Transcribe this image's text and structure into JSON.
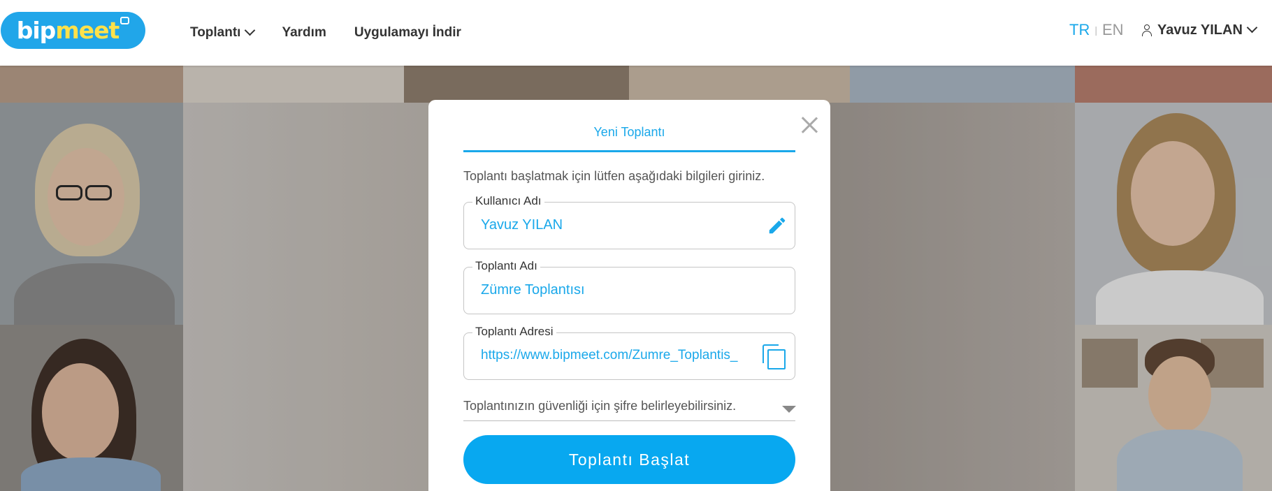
{
  "logo": {
    "part1": "bip",
    "part2": "meet"
  },
  "nav": {
    "meeting": "Toplantı",
    "help": "Yardım",
    "download": "Uygulamayı İndir"
  },
  "lang": {
    "tr": "TR",
    "separator": "|",
    "en": "EN"
  },
  "user": {
    "name": "Yavuz YILAN",
    "icon": "user-icon"
  },
  "modal": {
    "tab": "Yeni Toplantı",
    "instruction": "Toplantı başlatmak için lütfen aşağıdaki bilgileri giriniz.",
    "username": {
      "label": "Kullanıcı Adı",
      "value": "Yavuz YILAN",
      "icon": "pencil-icon"
    },
    "meeting_name": {
      "label": "Toplantı Adı",
      "value": "Zümre Toplantısı"
    },
    "meeting_address": {
      "label": "Toplantı Adresi",
      "value": "https://www.bipmeet.com/Zumre_Toplantis_",
      "icon": "copy-icon"
    },
    "password_hint": "Toplantınızın güvenliği için şifre belirleyebilirsiniz.",
    "start_button": "Toplantı Başlat"
  },
  "colors": {
    "accent": "#1aa8ea",
    "button": "#08a8f0",
    "logo_bg": "#21a6e9",
    "logo_meet": "#ffe14a"
  }
}
